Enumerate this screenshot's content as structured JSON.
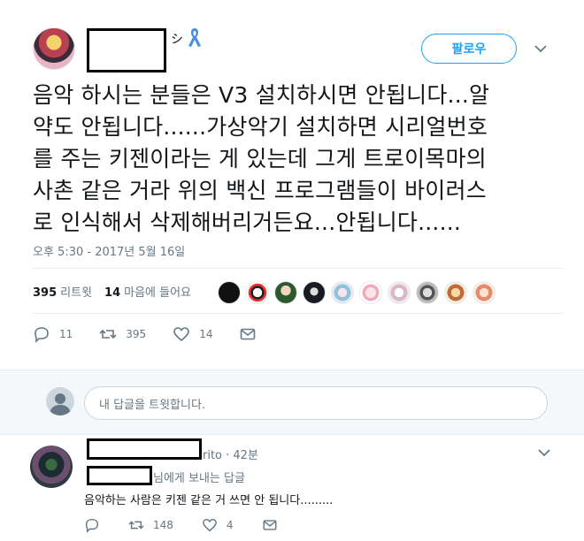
{
  "tweet": {
    "name_suffix": "シ",
    "follow_label": "팔로우",
    "text_lines": [
      "음악 하시는 분들은 V3 설치하시면 안됩니다...알",
      "약도 안됩니다......가상악기 설치하면 시리얼번호",
      "를 주는 키젠이라는 게 있는데 그게 트로이목마의",
      "사촌 같은 거라 위의 백신 프로그램들이 바이러스",
      "로 인식해서 삭제해버리거든요...안됩니다......"
    ],
    "timestamp": "오후 5:30 - 2017년 5월 16일",
    "retweet_count": "395",
    "retweet_label": "리트윗",
    "like_count": "14",
    "like_label": "마음에 들어요",
    "actions": {
      "reply_count": "11",
      "retweet_count": "395",
      "like_count": "14"
    }
  },
  "composer": {
    "placeholder": "내 답글을 트윗합니다."
  },
  "reply": {
    "handle_tail": "rito · 42분",
    "reply_to": "님에게 보내는 답글",
    "text": "음악하는 사람은 키젠 같은 거 쓰면 안 됩니다.........",
    "actions": {
      "reply_count": "",
      "retweet_count": "148",
      "like_count": "4"
    }
  },
  "colors": {
    "accent": "#1da1f2",
    "muted": "#657786",
    "ribbon": "#4a90d9"
  }
}
